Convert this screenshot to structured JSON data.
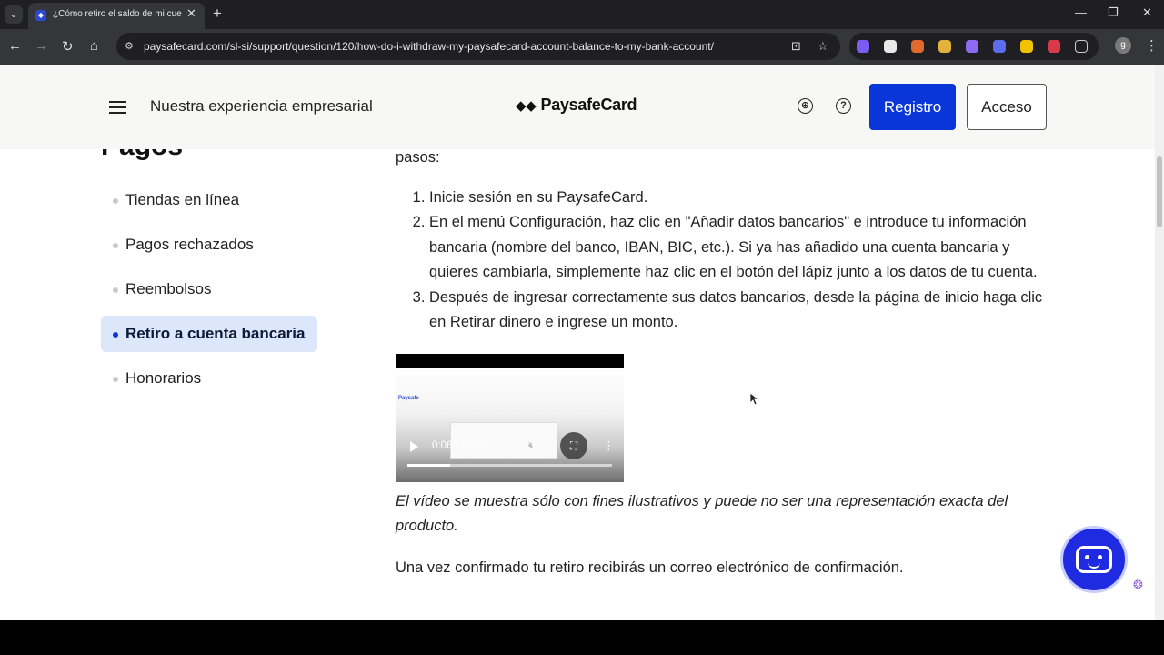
{
  "browser": {
    "tab_title": "¿Cómo retiro el saldo de mi cue",
    "tab_close": "✕",
    "new_tab": "+",
    "url": "paysafecard.com/sl-si/support/question/120/how-do-i-withdraw-my-paysafecard-account-balance-to-my-bank-account/",
    "profile_initial": "g"
  },
  "header": {
    "business_link": "Nuestra experiencia empresarial",
    "logo_text": "PaysafeCard",
    "register_button": "Registro",
    "login_button": "Acceso"
  },
  "sidebar": {
    "section_title": "Pagos",
    "items": [
      {
        "label": "Tiendas en línea",
        "active": false
      },
      {
        "label": "Pagos rechazados",
        "active": false
      },
      {
        "label": "Reembolsos",
        "active": false
      },
      {
        "label": "Retiro a cuenta bancaria",
        "active": true
      },
      {
        "label": "Honorarios",
        "active": false
      }
    ]
  },
  "article": {
    "intro_fragment": "pasos:",
    "steps": [
      "Inicie sesión en su PaysafeCard.",
      "En el menú Configuración, haz clic en \"Añadir datos bancarios\" e introduce tu información bancaria (nombre del banco, IBAN, BIC, etc.). Si ya has añadido una cuenta bancaria y quieres cambiarla, simplemente haz clic en el botón del lápiz junto a los datos de tu cuenta.",
      "Después de ingresar correctamente sus datos bancarios, desde la página de inicio haga clic en Retirar dinero e ingrese un monto."
    ],
    "video": {
      "time_display": "0:06 / 0:28",
      "thumbnail_logo": "Paysafe",
      "progress_fraction": 0.21
    },
    "disclaimer": "El vídeo se muestra sólo con fines ilustrativos y puede no ser una representación exacta del producto.",
    "confirmation": "Una vez confirmado tu retiro recibirás un correo electrónico de confirmación."
  },
  "colors": {
    "brand_blue": "#0a35d8",
    "active_bg": "#dde7fb",
    "header_bg": "#f7f7f5"
  }
}
